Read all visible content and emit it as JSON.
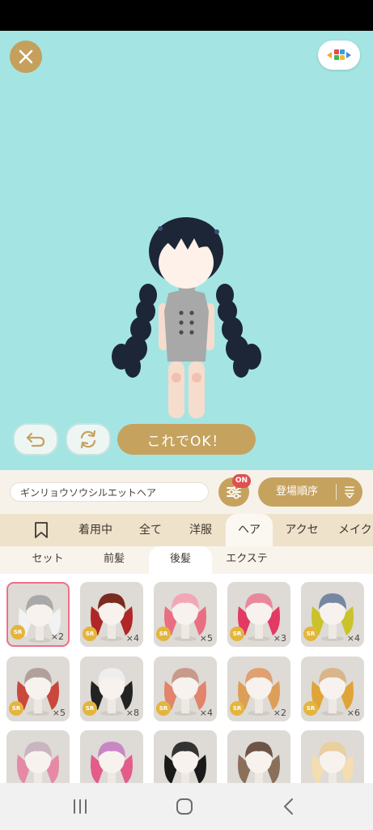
{
  "stage": {
    "ok_label": "これでOK！"
  },
  "infobar": {
    "item_name": "ギンリョウソウシルエットヘア",
    "filter_badge": "ON",
    "sort_label": "登場順序"
  },
  "tabs": [
    {
      "label": ""
    },
    {
      "label": "着用中"
    },
    {
      "label": "全て"
    },
    {
      "label": "洋服"
    },
    {
      "label": "ヘア"
    },
    {
      "label": "アクセ"
    },
    {
      "label": "メイク"
    }
  ],
  "subtabs": [
    {
      "label": "セット"
    },
    {
      "label": "前髪"
    },
    {
      "label": "後髪"
    },
    {
      "label": "エクステ"
    }
  ],
  "items": [
    {
      "rarity": "SR",
      "count": "×2",
      "hair": "#f2f2f2",
      "top": "#a9a9a9"
    },
    {
      "rarity": "SR",
      "count": "×4",
      "hair": "#b12626",
      "top": "#7a2a1e"
    },
    {
      "rarity": "SR",
      "count": "×5",
      "hair": "#ea6e82",
      "top": "#f3a7b6"
    },
    {
      "rarity": "SR",
      "count": "×3",
      "hair": "#e23a63",
      "top": "#e9879b"
    },
    {
      "rarity": "SR",
      "count": "×4",
      "hair": "#c9c22a",
      "top": "#7587a3"
    },
    {
      "rarity": "SR",
      "count": "×5",
      "hair": "#c9473c",
      "top": "#b2a19a"
    },
    {
      "rarity": "SR",
      "count": "×8",
      "hair": "#222222",
      "top": "#eeeeee"
    },
    {
      "rarity": "SR",
      "count": "×4",
      "hair": "#e2836b",
      "top": "#c89a8a"
    },
    {
      "rarity": "SR",
      "count": "×2",
      "hair": "#dd9e58",
      "top": "#e0a070"
    },
    {
      "rarity": "SR",
      "count": "×6",
      "hair": "#e0a437",
      "top": "#d9b58a"
    },
    {
      "rarity": "",
      "count": "",
      "hair": "#e48aa6",
      "top": "#c9b4c2"
    },
    {
      "rarity": "",
      "count": "",
      "hair": "#e45c8c",
      "top": "#c887c4"
    },
    {
      "rarity": "",
      "count": "",
      "hair": "#1a1a1a",
      "top": "#333333"
    },
    {
      "rarity": "",
      "count": "",
      "hair": "#8a6f5b",
      "top": "#6d5446"
    },
    {
      "rarity": "",
      "count": "",
      "hair": "#f3ddb1",
      "top": "#e9cfa0"
    }
  ],
  "icons": {
    "close": "close-icon",
    "background": "palette-icon",
    "undo": "undo-icon",
    "reset": "refresh-icon",
    "filter": "sliders-icon",
    "sort": "sort-order-icon",
    "bookmark": "bookmark-icon",
    "nav_recents": "recents-icon",
    "nav_home": "home-icon",
    "nav_back": "back-icon"
  },
  "colors": {
    "stage_bg": "#a4e5e3",
    "accent_gold": "#c6a25f",
    "tab_bg": "#efe2cb",
    "selected_border": "#ee6f89",
    "rarity_badge": "#e4b53d",
    "on_badge": "#e0504e"
  }
}
